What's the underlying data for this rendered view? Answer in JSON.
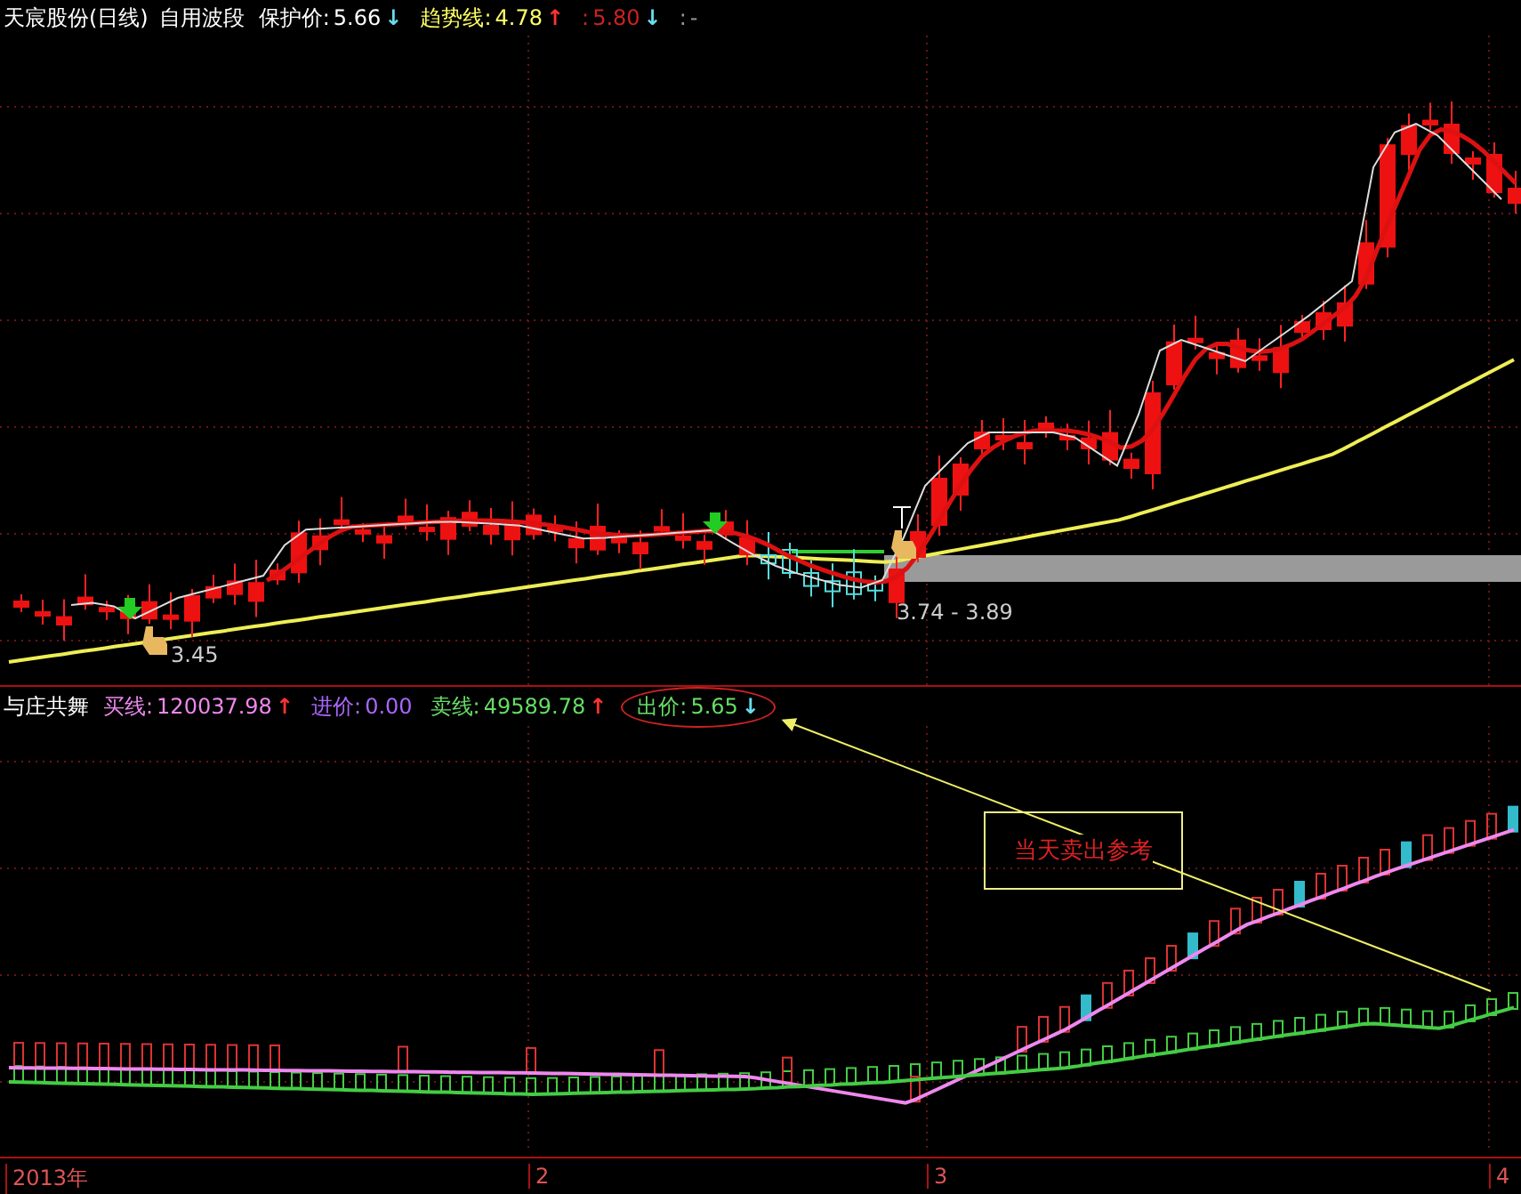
{
  "price_panel": {
    "title": "天宸股份(日线)",
    "indicator": "自用波段",
    "fields": [
      {
        "label": "保护价:",
        "value": "5.66",
        "arrow": "↓",
        "rising": false,
        "color": "#ffffff"
      },
      {
        "label": "趋势线:",
        "value": "4.78",
        "arrow": "↑",
        "rising": true,
        "color": "#ffff66"
      },
      {
        "label": ":",
        "value": "5.80",
        "arrow": "↓",
        "rising": false,
        "color": "#cc2222"
      },
      {
        "label": ":",
        "value": "-",
        "color": "#999999"
      }
    ],
    "annotations": [
      "3.45",
      "3.74 - 3.89"
    ]
  },
  "indicator_panel": {
    "title": "与庄共舞",
    "fields": [
      {
        "label": "买线:",
        "value": "120037.98",
        "arrow": "↑",
        "rising": true,
        "color": "#ee88ee",
        "circled": false
      },
      {
        "label": "进价:",
        "value": "0.00",
        "color": "#aa66ff",
        "circled": false
      },
      {
        "label": "卖线:",
        "value": "49589.78",
        "arrow": "↑",
        "rising": true,
        "color": "#66dd66",
        "circled": false
      },
      {
        "label": "出价:",
        "value": "5.65",
        "arrow": "↓",
        "rising": false,
        "color": "#66dd66",
        "circled": true
      }
    ],
    "callout": "当天卖出参考"
  },
  "time_axis": [
    "2013年",
    "2",
    "3",
    "4"
  ]
}
